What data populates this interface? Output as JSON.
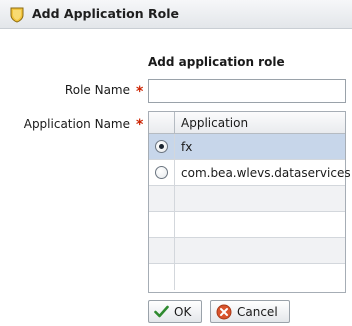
{
  "dialog": {
    "title": "Add Application Role",
    "title_icon": "shield-icon"
  },
  "form": {
    "heading": "Add application role",
    "role_name_label": "Role Name",
    "role_name_value": "",
    "application_name_label": "Application Name",
    "required_marker": "*"
  },
  "grid": {
    "column_header": "Application",
    "rows": [
      {
        "label": "fx",
        "selected": true
      },
      {
        "label": "com.bea.wlevs.dataservices",
        "selected": false
      }
    ],
    "empty_rows": 5
  },
  "buttons": {
    "ok_label": "OK",
    "ok_icon": "checkmark-icon",
    "cancel_label": "Cancel",
    "cancel_icon": "cancel-icon"
  },
  "colors": {
    "selected_row": "#c7d6ea",
    "required": "#cc2200",
    "ok_check": "#2f8a2f",
    "cancel_icon": "#d9532c"
  }
}
